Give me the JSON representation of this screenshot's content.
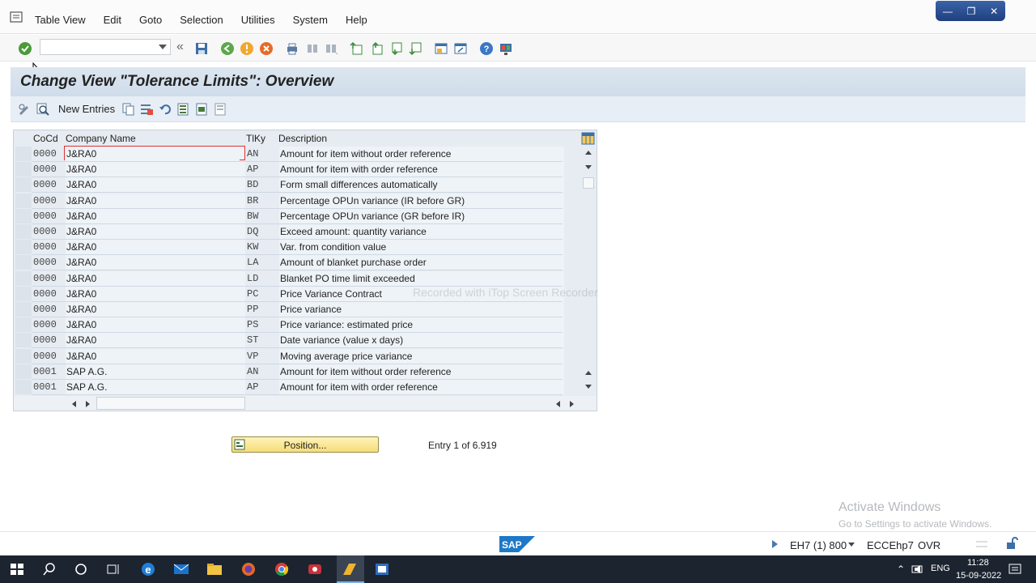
{
  "menubar": {
    "items": [
      "Table View",
      "Edit",
      "Goto",
      "Selection",
      "Utilities",
      "System",
      "Help"
    ]
  },
  "toolbar": {
    "command_value": "",
    "icons": [
      "enter-icon",
      "back-double-icon",
      "save-icon",
      "back-icon",
      "exit-icon",
      "cancel-icon",
      "print-icon",
      "find-icon",
      "find-next-icon",
      "first-page-icon",
      "prev-page-icon",
      "next-page-icon",
      "last-page-icon",
      "new-session-icon",
      "shortcut-icon",
      "help-icon",
      "customize-layout-icon"
    ]
  },
  "page": {
    "title": "Change View \"Tolerance Limits\": Overview"
  },
  "app_toolbar": {
    "new_entries_label": "New Entries",
    "icons": [
      "display-change-icon",
      "details-icon",
      "copy-as-icon",
      "delete-icon",
      "undo-change-icon",
      "select-all-icon",
      "select-block-icon",
      "deselect-all-icon"
    ]
  },
  "table": {
    "columns": [
      "CoCd",
      "Company Name",
      "TlKy",
      "Description"
    ],
    "rows": [
      {
        "cocd": "0000",
        "name": "J&RA0",
        "tlky": "AN",
        "desc": "Amount for item without order reference"
      },
      {
        "cocd": "0000",
        "name": "J&RA0",
        "tlky": "AP",
        "desc": "Amount for item with order reference"
      },
      {
        "cocd": "0000",
        "name": "J&RA0",
        "tlky": "BD",
        "desc": "Form small differences automatically"
      },
      {
        "cocd": "0000",
        "name": "J&RA0",
        "tlky": "BR",
        "desc": "Percentage OPUn variance (IR before GR)"
      },
      {
        "cocd": "0000",
        "name": "J&RA0",
        "tlky": "BW",
        "desc": "Percentage OPUn variance (GR before IR)"
      },
      {
        "cocd": "0000",
        "name": "J&RA0",
        "tlky": "DQ",
        "desc": "Exceed amount: quantity variance"
      },
      {
        "cocd": "0000",
        "name": "J&RA0",
        "tlky": "KW",
        "desc": "Var. from condition value"
      },
      {
        "cocd": "0000",
        "name": "J&RA0",
        "tlky": "LA",
        "desc": "Amount of blanket purchase order"
      },
      {
        "cocd": "0000",
        "name": "J&RA0",
        "tlky": "LD",
        "desc": "Blanket PO time limit exceeded"
      },
      {
        "cocd": "0000",
        "name": "J&RA0",
        "tlky": "PC",
        "desc": "Price Variance Contract"
      },
      {
        "cocd": "0000",
        "name": "J&RA0",
        "tlky": "PP",
        "desc": "Price variance"
      },
      {
        "cocd": "0000",
        "name": "J&RA0",
        "tlky": "PS",
        "desc": "Price variance: estimated price"
      },
      {
        "cocd": "0000",
        "name": "J&RA0",
        "tlky": "ST",
        "desc": "Date variance (value x days)"
      },
      {
        "cocd": "0000",
        "name": "J&RA0",
        "tlky": "VP",
        "desc": "Moving average price variance"
      },
      {
        "cocd": "0001",
        "name": "SAP A.G.",
        "tlky": "AN",
        "desc": "Amount for item without order reference"
      },
      {
        "cocd": "0001",
        "name": "SAP A.G.",
        "tlky": "AP",
        "desc": "Amount for item with order reference"
      }
    ]
  },
  "position_button": {
    "label": "Position..."
  },
  "entry_info": "Entry 1 of 6.919",
  "watermark": "Recorded with iTop Screen Recorder",
  "activate_windows": {
    "title": "Activate Windows",
    "subtitle": "Go to Settings to activate Windows."
  },
  "statusbar": {
    "system": "EH7 (1) 800",
    "server": "ECCEhp7",
    "mode": "OVR"
  },
  "taskbar": {
    "language": "ENG",
    "time": "11:28",
    "date": "15-09-2022",
    "apps": [
      "windows-start-icon",
      "search-icon",
      "cortana-icon",
      "task-view-icon",
      "edge-icon",
      "mail-icon",
      "file-explorer-icon",
      "firefox-icon",
      "chrome-icon",
      "screen-recorder-icon",
      "sap-logon-icon",
      "sap-gui-icon"
    ]
  }
}
